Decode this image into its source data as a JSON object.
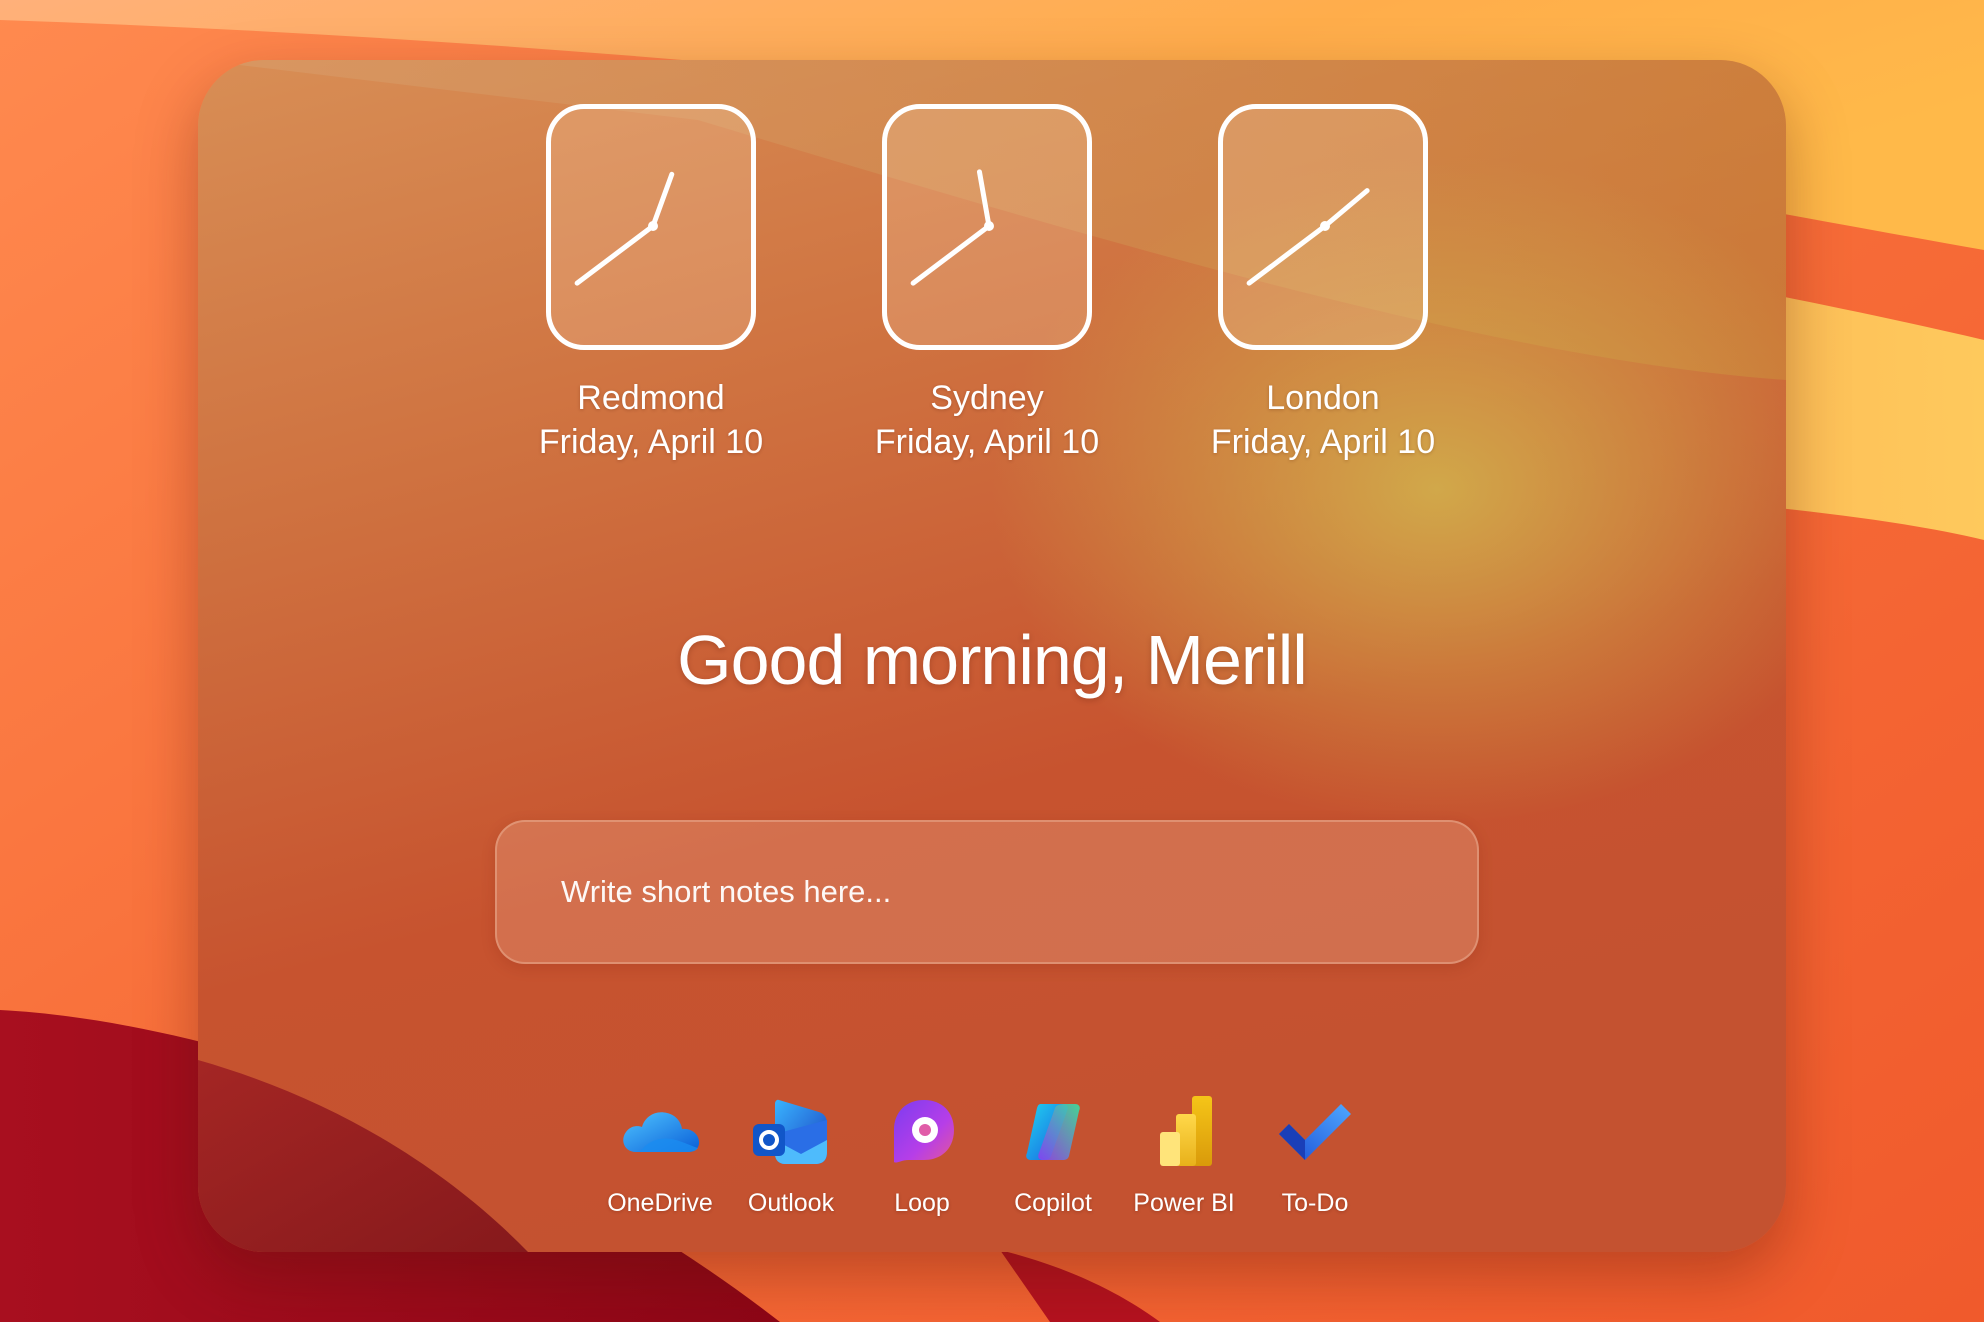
{
  "greeting": "Good morning, Merill",
  "clocks": [
    {
      "city": "Redmond",
      "date": "Friday, April 10",
      "hour_angle_deg": 20,
      "minute_angle_deg": 233
    },
    {
      "city": "Sydney",
      "date": "Friday, April 10",
      "hour_angle_deg": 350,
      "minute_angle_deg": 233
    },
    {
      "city": "London",
      "date": "Friday, April 10",
      "hour_angle_deg": 50,
      "minute_angle_deg": 233
    }
  ],
  "notes": {
    "placeholder": "Write short notes here..."
  },
  "apps": [
    {
      "label": "OneDrive",
      "icon": "onedrive-icon"
    },
    {
      "label": "Outlook",
      "icon": "outlook-icon"
    },
    {
      "label": "Loop",
      "icon": "loop-icon"
    },
    {
      "label": "Copilot",
      "icon": "copilot-icon"
    },
    {
      "label": "Power BI",
      "icon": "power-bi-icon"
    },
    {
      "label": "To-Do",
      "icon": "to-do-icon"
    }
  ],
  "colors": {
    "text": "#ffffff",
    "clock_border": "#ffffff",
    "accent_orange": "#f47a3d"
  }
}
